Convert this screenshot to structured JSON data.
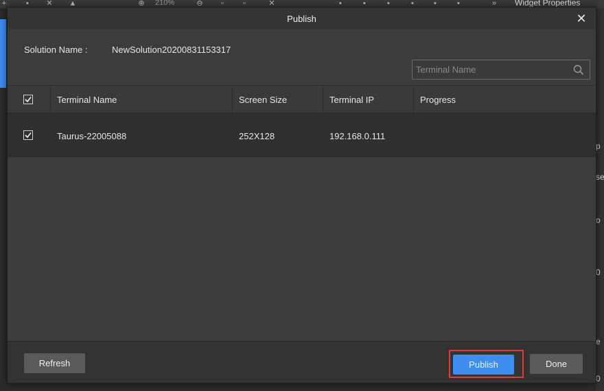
{
  "background": {
    "zoom_text": "210%",
    "widget_panel_title": "Widget Properties",
    "right_panel_fragments": [
      "p",
      "se",
      "o",
      "0",
      "e",
      "0"
    ]
  },
  "dialog": {
    "title": "Publish",
    "close_glyph": "✕",
    "solution_label": "Solution Name :",
    "solution_value": "NewSolution20200831153317",
    "search": {
      "placeholder": "Terminal Name",
      "value": ""
    },
    "table": {
      "headers": {
        "terminal_name": "Terminal Name",
        "screen_size": "Screen Size",
        "terminal_ip": "Terminal IP",
        "progress": "Progress"
      },
      "header_checked": true,
      "rows": [
        {
          "checked": true,
          "terminal_name": "Taurus-22005088",
          "screen_size": "252X128",
          "terminal_ip": "192.168.0.111",
          "progress": ""
        }
      ]
    },
    "buttons": {
      "refresh": "Refresh",
      "publish": "Publish",
      "done": "Done"
    }
  },
  "colors": {
    "accent": "#3d8ef0",
    "highlight": "#e03a3a",
    "dialog_bg": "#3c3c3c"
  }
}
